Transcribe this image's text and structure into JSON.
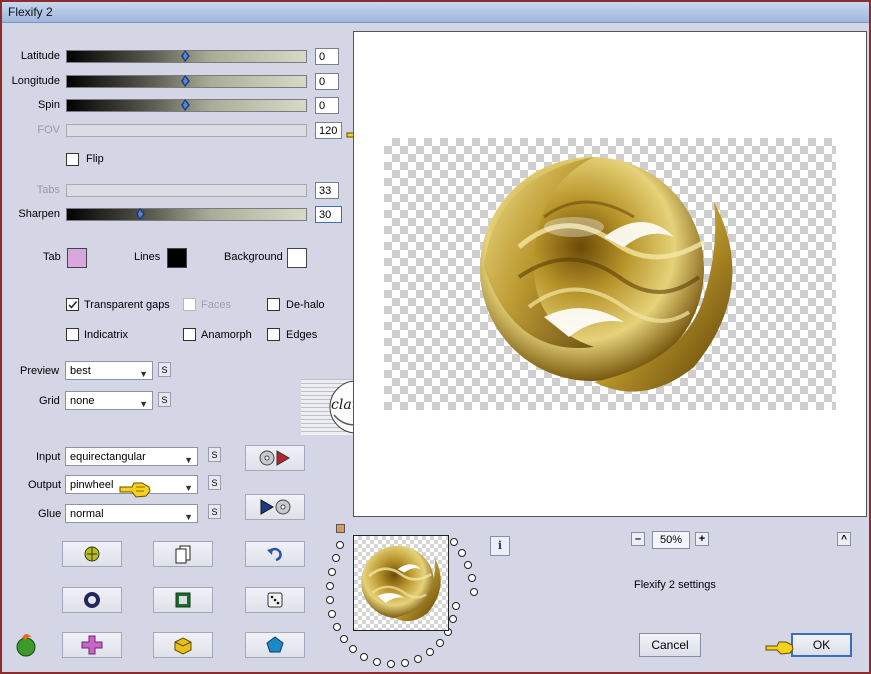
{
  "window": {
    "title": "Flexify 2"
  },
  "sliders": [
    {
      "label": "Latitude",
      "value": "0",
      "level": 0.5,
      "enabled": true
    },
    {
      "label": "Longitude",
      "value": "0",
      "level": 0.5,
      "enabled": true
    },
    {
      "label": "Spin",
      "value": "0",
      "level": 0.5,
      "enabled": true
    },
    {
      "label": "FOV",
      "value": "120",
      "enabled": false
    },
    {
      "label": "Tabs",
      "value": "33",
      "enabled": false
    },
    {
      "label": "Sharpen",
      "value": "30",
      "level": 0.3,
      "enabled": true
    }
  ],
  "flip": {
    "label": "Flip",
    "checked": false
  },
  "colors": {
    "tab": {
      "label": "Tab",
      "value": "#d8a8dc"
    },
    "lines": {
      "label": "Lines",
      "value": "#000000"
    },
    "background": {
      "label": "Background",
      "value": "#ffffff"
    }
  },
  "checkboxes": {
    "transparent_gaps": {
      "label": "Transparent gaps",
      "checked": true
    },
    "faces": {
      "label": "Faces",
      "checked": false,
      "enabled": false
    },
    "de_halo": {
      "label": "De-halo",
      "checked": false
    },
    "indicatrix": {
      "label": "Indicatrix",
      "checked": false
    },
    "anamorph": {
      "label": "Anamorph",
      "checked": false
    },
    "edges": {
      "label": "Edges",
      "checked": false
    }
  },
  "preview_select": {
    "label": "Preview",
    "value": "best"
  },
  "grid_select": {
    "label": "Grid",
    "value": "none"
  },
  "input_select": {
    "label": "Input",
    "value": "equirectangular"
  },
  "output_select": {
    "label": "Output",
    "value": "pinwheel"
  },
  "glue_select": {
    "label": "Glue",
    "value": "normal"
  },
  "s_button": "S",
  "watermark": "claudia",
  "zoom": {
    "minus": "–",
    "value": "50%",
    "plus": "+"
  },
  "info_icon": "i",
  "scroll_up": "^",
  "settings_name": "Flexify 2 settings",
  "buttons": {
    "cancel": "Cancel",
    "ok": "OK"
  },
  "accent": "#3a6dc0"
}
